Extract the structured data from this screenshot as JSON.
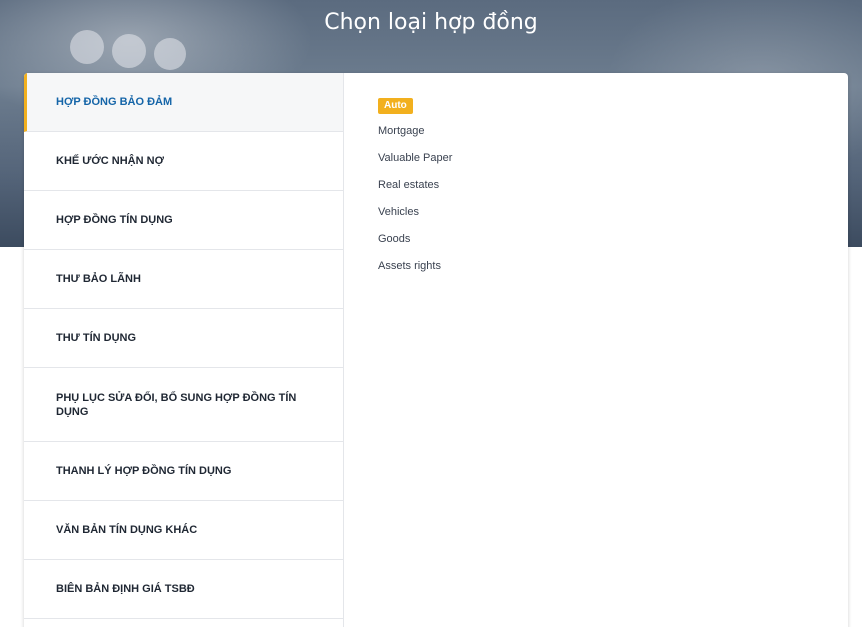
{
  "header": {
    "title": "Chọn loại hợp đồng"
  },
  "sidebar": {
    "items": [
      {
        "label": "HỢP ĐỒNG BẢO ĐẢM",
        "active": true
      },
      {
        "label": "KHẾ ƯỚC NHẬN NỢ",
        "active": false
      },
      {
        "label": "HỢP ĐỒNG TÍN DỤNG",
        "active": false
      },
      {
        "label": "THƯ BẢO LÃNH",
        "active": false
      },
      {
        "label": "THƯ TÍN DỤNG",
        "active": false
      },
      {
        "label": "PHỤ LỤC SỬA ĐỔI, BỔ SUNG HỢP ĐỒNG TÍN DỤNG",
        "active": false
      },
      {
        "label": "THANH LÝ HỢP ĐỒNG TÍN DỤNG",
        "active": false
      },
      {
        "label": "VĂN BẢN TÍN DỤNG KHÁC",
        "active": false
      },
      {
        "label": "BIÊN BẢN ĐỊNH GIÁ TSBĐ",
        "active": false
      }
    ]
  },
  "main": {
    "badge": "Auto",
    "items": [
      {
        "label": "Mortgage"
      },
      {
        "label": "Valuable Paper"
      },
      {
        "label": "Real estates"
      },
      {
        "label": "Vehicles"
      },
      {
        "label": "Goods"
      },
      {
        "label": "Assets rights"
      }
    ]
  },
  "colors": {
    "accent": "#f2b01e",
    "active_text": "#1565a8"
  }
}
